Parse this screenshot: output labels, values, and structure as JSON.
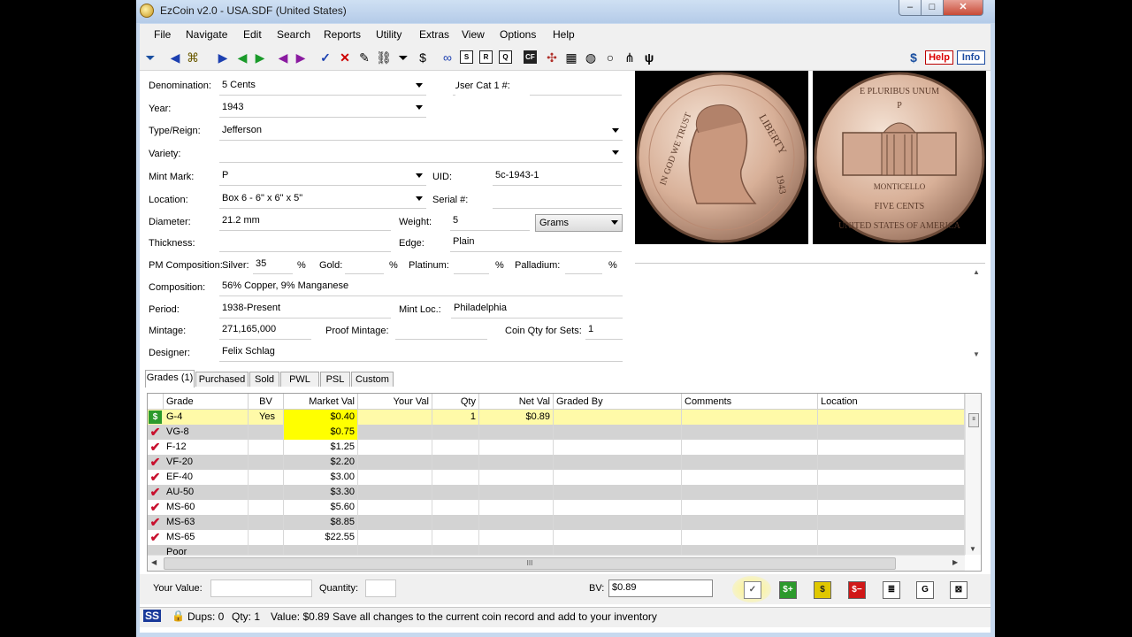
{
  "window": {
    "title": "EzCoin v2.0 - USA.SDF (United States)",
    "min": "–",
    "max": "□",
    "close": "✕"
  },
  "menu": [
    "File",
    "Navigate",
    "Edit",
    "Search",
    "Reports",
    "Utility",
    "Extras",
    "View",
    "Options",
    "Help"
  ],
  "toolbar": {
    "help_label": "Help",
    "info_label": "Info",
    "sq1": "S",
    "sq2": "R",
    "sq3": "Q",
    "sq4": "CF",
    "psi": "ψ"
  },
  "form": {
    "denomination_label": "Denomination:",
    "denomination": "5 Cents",
    "year_label": "Year:",
    "year": "1943",
    "type_label": "Type/Reign:",
    "type": "Jefferson",
    "variety_label": "Variety:",
    "variety": "",
    "mint_mark_label": "Mint Mark:",
    "mint_mark": "P",
    "location_label": "Location:",
    "location": "Box 6 - 6\" x 6\" x 5\"",
    "diameter_label": "Diameter:",
    "diameter": "21.2 mm",
    "thickness_label": "Thickness:",
    "thickness": "",
    "pm_label": "PM Composition:",
    "silver_label": "Silver:",
    "silver": "35",
    "pct": "%",
    "gold_label": "Gold:",
    "gold": "",
    "platinum_label": "Platinum:",
    "platinum": "",
    "palladium_label": "Palladium:",
    "palladium": "",
    "composition_label": "Composition:",
    "composition": "56% Copper, 9% Manganese",
    "period_label": "Period:",
    "period": "1938-Present",
    "mintage_label": "Mintage:",
    "mintage": "271,165,000",
    "designer_label": "Designer:",
    "designer": "Felix Schlag",
    "user_cat_label": "User Cat 1 #:",
    "user_cat": "",
    "uid_label": "UID:",
    "uid": "5c-1943-1",
    "serial_label": "Serial #:",
    "serial": "",
    "weight_label": "Weight:",
    "weight": "5",
    "weight_unit": "Grams",
    "edge_label": "Edge:",
    "edge": "Plain",
    "mint_loc_label": "Mint Loc.:",
    "mint_loc": "Philadelphia",
    "proof_mintage_label": "Proof Mintage:",
    "proof_mintage": "",
    "coin_qty_label": "Coin Qty for Sets:",
    "coin_qty": "1"
  },
  "coin_images": {
    "obverse_text_left": "IN GOD WE TRUST",
    "obverse_text_right": "LIBERTY",
    "obverse_year": "1943",
    "reverse_top": "E PLURIBUS UNUM",
    "reverse_mm": "P",
    "reverse_building": "MONTICELLO",
    "reverse_value": "FIVE CENTS",
    "reverse_bottom": "UNITED STATES OF AMERICA"
  },
  "tabs": [
    "Grades (1)",
    "Purchased",
    "Sold",
    "PWL",
    "PSL",
    "Custom"
  ],
  "grid": {
    "columns": [
      "Grade",
      "BV",
      "Market Val",
      "Your Val",
      "Qty",
      "Net Val",
      "Graded By",
      "Comments",
      "Location"
    ],
    "rows": [
      {
        "grade": "G-4",
        "bv": "Yes",
        "market": "$0.40",
        "your": "",
        "qty": "1",
        "net": "$0.89"
      },
      {
        "grade": "VG-8",
        "bv": "",
        "market": "$0.75",
        "your": "",
        "qty": "",
        "net": ""
      },
      {
        "grade": "F-12",
        "bv": "",
        "market": "$1.25",
        "your": "",
        "qty": "",
        "net": ""
      },
      {
        "grade": "VF-20",
        "bv": "",
        "market": "$2.20",
        "your": "",
        "qty": "",
        "net": ""
      },
      {
        "grade": "EF-40",
        "bv": "",
        "market": "$3.00",
        "your": "",
        "qty": "",
        "net": ""
      },
      {
        "grade": "AU-50",
        "bv": "",
        "market": "$3.30",
        "your": "",
        "qty": "",
        "net": ""
      },
      {
        "grade": "MS-60",
        "bv": "",
        "market": "$5.60",
        "your": "",
        "qty": "",
        "net": ""
      },
      {
        "grade": "MS-63",
        "bv": "",
        "market": "$8.85",
        "your": "",
        "qty": "",
        "net": ""
      },
      {
        "grade": "MS-65",
        "bv": "",
        "market": "$22.55",
        "your": "",
        "qty": "",
        "net": ""
      },
      {
        "grade": "Poor",
        "bv": "",
        "market": "",
        "your": "",
        "qty": "",
        "net": ""
      }
    ],
    "hscroll_grip": "III"
  },
  "bottom": {
    "your_value_label": "Your Value:",
    "quantity_label": "Quantity:",
    "bv_label": "BV:",
    "bv_value": "$0.89"
  },
  "status": {
    "icon": "SS",
    "dups": "Dups: 0",
    "qty": "Qty: 1",
    "value": "Value: $0.89",
    "message": "Save all changes to the current coin record and add to your inventory"
  },
  "colors": {
    "highlight_row": "#fffaa8",
    "market_yellow": "#ffff00",
    "alt_row": "#d3d3d3",
    "check_red": "#c8102e"
  }
}
